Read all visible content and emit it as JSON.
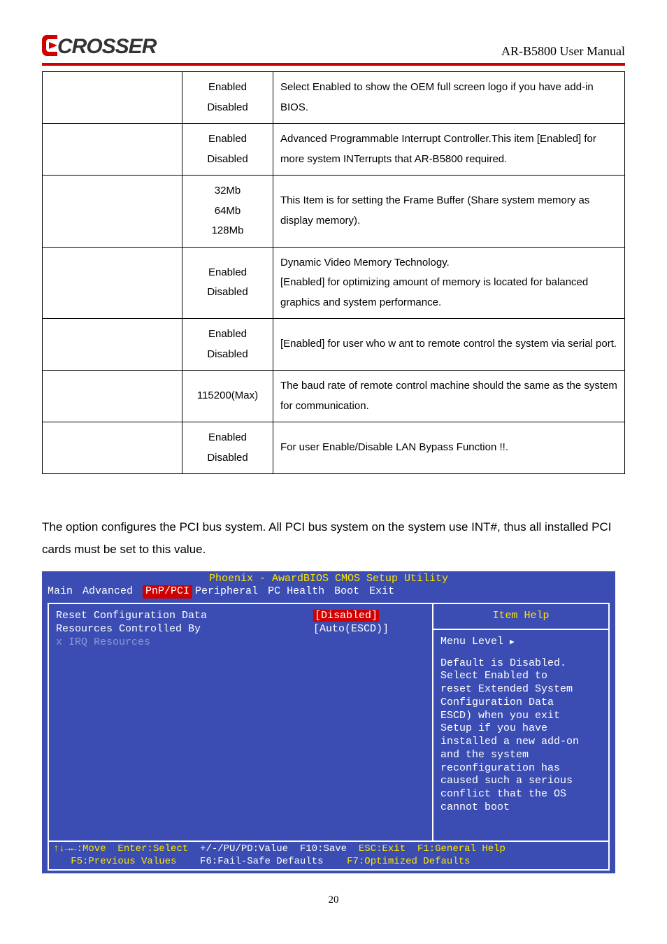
{
  "header": {
    "logo_text": "CROSSER",
    "manual_title": "AR-B5800 User Manual"
  },
  "table": {
    "rows": [
      {
        "label": "",
        "choices": "Enabled\nDisabled",
        "desc": "Select Enabled to show the OEM full screen logo if you have add-in BIOS."
      },
      {
        "label": "",
        "choices": "Enabled\nDisabled",
        "desc": "Advanced Programmable Interrupt Controller.This item [Enabled] for more system INTerrupts that AR-B5800 required."
      },
      {
        "label": "",
        "choices": "32Mb\n64Mb\n128Mb",
        "desc": "This Item is for setting the Frame Buffer (Share system memory as display memory)."
      },
      {
        "label": "",
        "choices": "Enabled\nDisabled",
        "desc": "Dynamic Video Memory Technology.\n[Enabled] for optimizing amount of memory is located for balanced graphics and system performance."
      },
      {
        "label": "",
        "choices": "Enabled\nDisabled",
        "desc": "[Enabled] for user who w ant to remote control the system via serial port."
      },
      {
        "label": "",
        "choices": "115200(Max)",
        "desc": "The baud rate of remote control machine should the same as the system for communication."
      },
      {
        "label": "",
        "choices": "Enabled\nDisabled",
        "desc": "For user Enable/Disable LAN Bypass Function !!."
      }
    ]
  },
  "paragraph": "The option configures the PCI bus system. All PCI bus system on the system use INT#, thus all installed PCI cards must be set to this value.",
  "bios": {
    "title": "Phoenix - AwardBIOS CMOS Setup Utility",
    "tabs": [
      "Main",
      "Advanced",
      "PnP/PCI",
      "Peripheral",
      "PC Health",
      "Boot",
      "Exit"
    ],
    "active_tab": "PnP/PCI",
    "left_items": [
      {
        "label": "Reset Configuration Data",
        "value": "[Disabled]",
        "selected": true,
        "dim": false
      },
      {
        "label": "",
        "value": "",
        "selected": false,
        "dim": false
      },
      {
        "label": "Resources Controlled By",
        "value": "[Auto(ESCD)]",
        "selected": false,
        "dim": false
      },
      {
        "label": "x IRQ Resources",
        "value": "",
        "selected": false,
        "dim": true
      }
    ],
    "right_title": "Item Help",
    "menu_level": "Menu Level   ",
    "help_text": "Default is Disabled.\nSelect Enabled to\nreset Extended System\nConfiguration Data\nESCD) when you exit\nSetup if you have\ninstalled a new add-on\nand the system\nreconfiguration has\ncaused such a serious\nconflict that the OS\ncannot boot",
    "footer_line1_a": "↑↓→←:Move  Enter:Select  ",
    "footer_line1_b": "+/-/PU/PD:Value  F10:Save  ",
    "footer_line1_c": "ESC:Exit  F1:General Help",
    "footer_line2_a": "   F5:Previous Values    ",
    "footer_line2_b": "F6:Fail-Safe Defaults    ",
    "footer_line2_c": "F7:Optimized Defaults"
  },
  "page_number": "20"
}
